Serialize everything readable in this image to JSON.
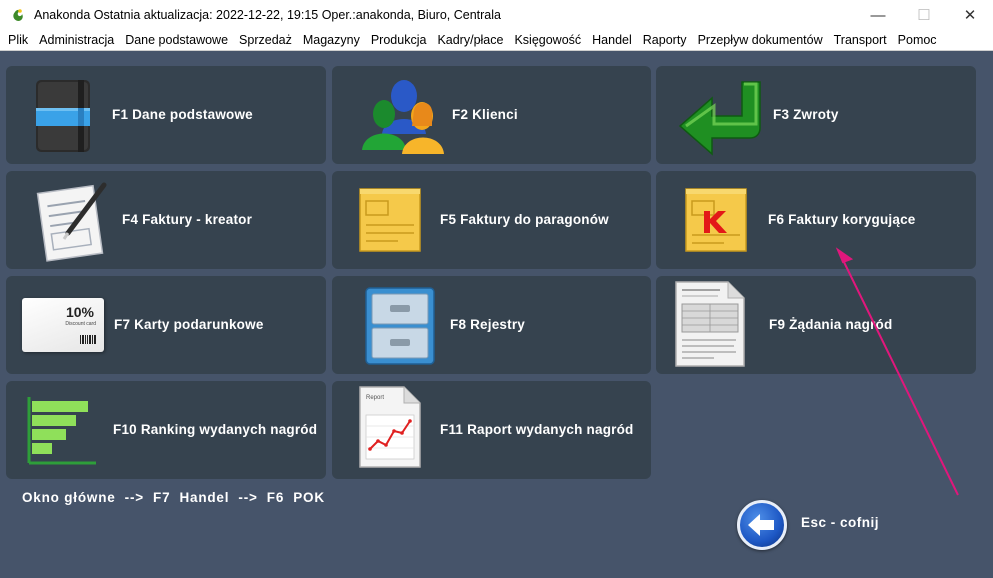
{
  "window": {
    "title": "Anakonda Ostatnia aktualizacja: 2022-12-22, 19:15 Oper.:anakonda, Biuro, Centrala",
    "minimize": "—",
    "maximize": "☐",
    "close": "✕"
  },
  "menu": [
    "Plik",
    "Administracja",
    "Dane podstawowe",
    "Sprzedaż",
    "Magazyny",
    "Produkcja",
    "Kadry/płace",
    "Księgowość",
    "Handel",
    "Raporty",
    "Przepływ dokumentów",
    "Transport",
    "Pomoc"
  ],
  "tiles": [
    {
      "label": "F1  Dane podstawowe",
      "icon": "notebook-icon"
    },
    {
      "label": "F2  Klienci",
      "icon": "people-icon"
    },
    {
      "label": "F3  Zwroty",
      "icon": "return-arrow-icon"
    },
    {
      "label": "F4  Faktury - kreator",
      "icon": "document-pen-icon"
    },
    {
      "label": "F5  Faktury do paragonów",
      "icon": "yellow-document-icon"
    },
    {
      "label": "F6  Faktury korygujące",
      "icon": "correction-document-icon"
    },
    {
      "label": "F7  Karty podarunkowe",
      "icon": "gift-card-icon"
    },
    {
      "label": "F8  Rejestry",
      "icon": "filing-cabinet-icon"
    },
    {
      "label": "F9  Żądania nagród",
      "icon": "report-document-icon"
    },
    {
      "label": "F10  Ranking wydanych nagród",
      "icon": "bar-ranking-icon"
    },
    {
      "label": "F11  Raport wydanych nagród",
      "icon": "line-report-icon"
    }
  ],
  "giftcard": {
    "percent": "10%",
    "caption": "Discount card"
  },
  "report_thumb": {
    "title": "Report"
  },
  "breadcrumb": "Okno główne  -->  F7  Handel  -->  F6  POK",
  "esc_label": "Esc - cofnij",
  "colors": {
    "background": "#46546a",
    "tile": "#36434f",
    "annotation_arrow": "#e0177c"
  }
}
